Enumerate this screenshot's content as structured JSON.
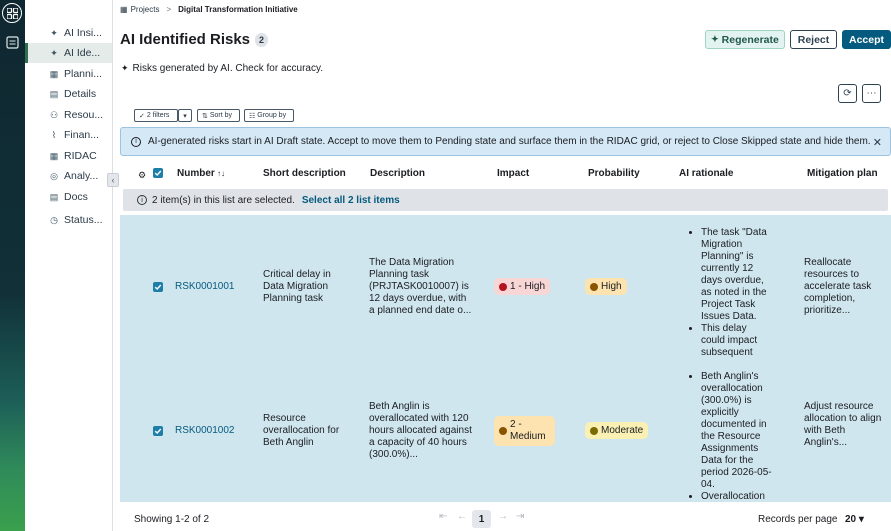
{
  "rail": {
    "home_icon": "grid-icon",
    "doc_icon": "document-icon"
  },
  "subnav": {
    "items": [
      {
        "label": "AI Insi...",
        "icon": "sparkle-icon",
        "active": false
      },
      {
        "label": "AI Ide...",
        "icon": "sparkle-icon",
        "active": true
      },
      {
        "label": "Planni...",
        "icon": "calendar-icon",
        "active": false
      },
      {
        "label": "Details",
        "icon": "details-icon",
        "active": false
      },
      {
        "label": "Resou...",
        "icon": "people-icon",
        "active": false
      },
      {
        "label": "Finan...",
        "icon": "chart-icon",
        "active": false
      },
      {
        "label": "RIDAC",
        "icon": "grid-icon",
        "active": false
      },
      {
        "label": "Analy...",
        "icon": "analytics-icon",
        "active": false
      },
      {
        "label": "Docs",
        "icon": "docs-icon",
        "active": false
      },
      {
        "label": "Status...",
        "icon": "status-icon",
        "active": false
      }
    ],
    "collapse_glyph": "‹"
  },
  "breadcrumb": {
    "root": "Projects",
    "separator": ">",
    "current": "Digital Transformation Initiative"
  },
  "header": {
    "title": "AI Identified Risks",
    "count": "2",
    "regenerate_label": "Regenerate",
    "reject_label": "Reject",
    "accept_label": "Accept",
    "ai_note": "Risks generated by AI. Check for accuracy."
  },
  "toolbar": {
    "filters_label": "2 filters",
    "sort_label": "Sort by",
    "group_label": "Group by"
  },
  "banner": {
    "text": "AI-generated risks start in AI Draft state. Accept to move them to Pending state and surface them in the RIDAC grid, or reject to Close Skipped state and hide them."
  },
  "table": {
    "columns": {
      "number": "Number",
      "short_description": "Short description",
      "description": "Description",
      "impact": "Impact",
      "probability": "Probability",
      "ai_rationale": "AI rationale",
      "mitigation_plan": "Mitigation plan"
    },
    "selection": {
      "text": "2 item(s) in this list are selected.",
      "link": "Select all 2 list items"
    },
    "rows": [
      {
        "number": "RSK0001001",
        "short_description": "Critical delay in Data Migration Planning task",
        "description": "The Data Migration Planning task (PRJTASK0010007) is 12 days overdue, with a planned end date o...",
        "impact": "1 - High",
        "impact_color": "#b3141d",
        "impact_bg": "#f9d6d6",
        "probability": "High",
        "probability_color": "#8a5300",
        "probability_bg": "#fce3b0",
        "ai_rationale": [
          "The task \"Data Migration Planning\" is currently 12 days overdue, as noted in the Project Task Issues Data.",
          "This delay could impact subsequent"
        ],
        "mitigation_plan": "Reallocate resources to accelerate task completion, prioritize..."
      },
      {
        "number": "RSK0001002",
        "short_description": "Resource overallocation for Beth Anglin",
        "description": "Beth Anglin is overallocated with 120 hours allocated against a capacity of 40 hours (300.0%)...",
        "impact": "2 - Medium",
        "impact_color": "#8a5300",
        "impact_bg": "#fce3b0",
        "probability": "Moderate",
        "probability_color": "#7a6a00",
        "probability_bg": "#fbf0b3",
        "ai_rationale": [
          "Beth Anglin's overallocation (300.0%) is explicitly documented in the Resource Assignments Data for the period 2026-05-04.",
          "Overallocation"
        ],
        "mitigation_plan": "Adjust resource allocation to align with Beth Anglin's..."
      }
    ]
  },
  "footer": {
    "showing": "Showing 1-2 of 2",
    "current_page": "1",
    "records_label": "Records per page",
    "records_value": "20"
  }
}
